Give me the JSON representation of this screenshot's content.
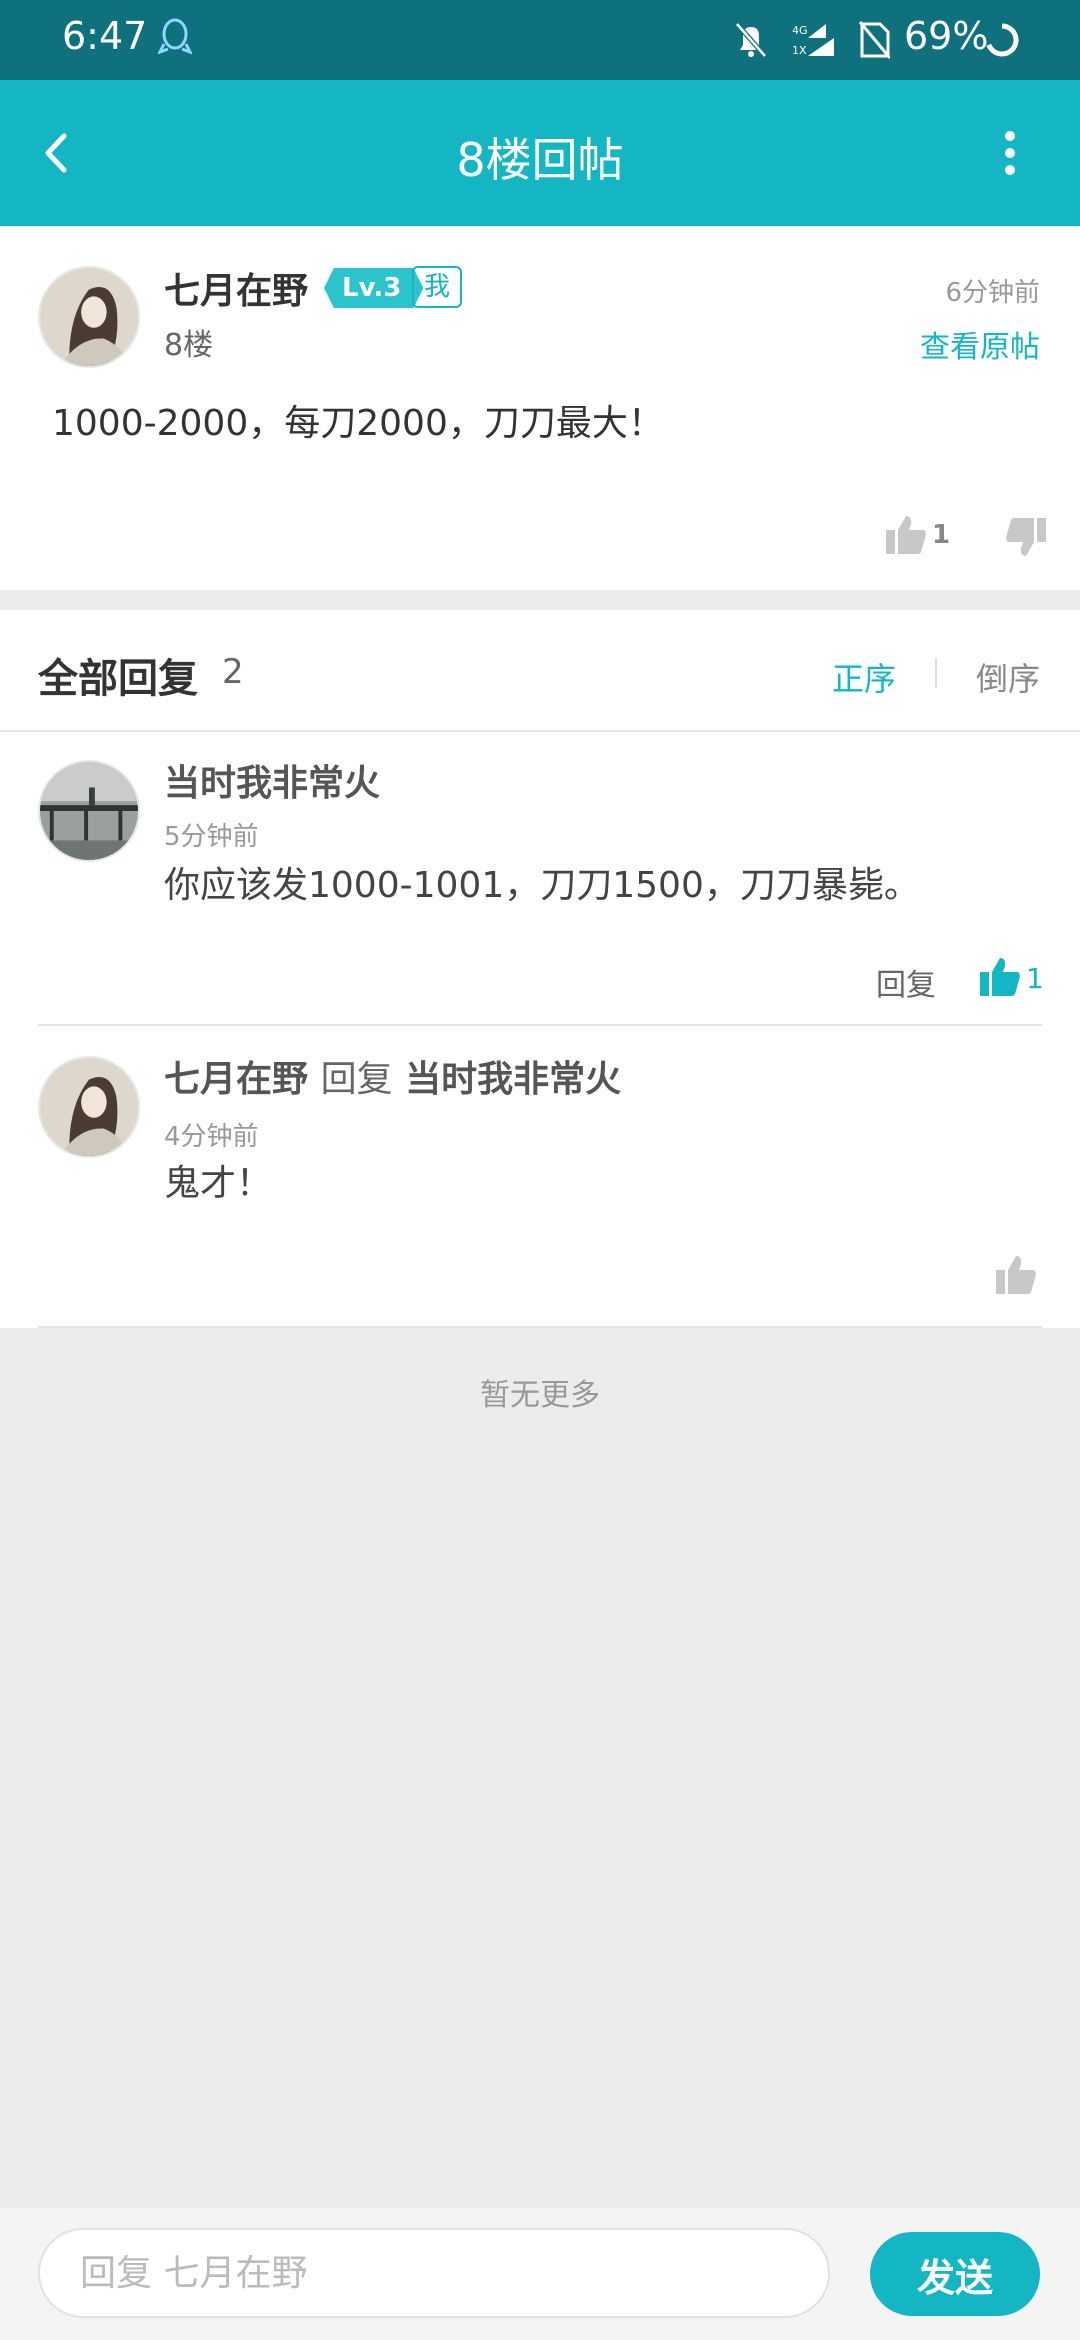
{
  "status_bar": {
    "time": "6:47",
    "battery": "69%",
    "network": "4G 1X"
  },
  "header": {
    "title": "8楼回帖",
    "back_icon": "chevron-left-icon",
    "more_icon": "more-vertical-icon"
  },
  "post": {
    "author": "七月在野",
    "level": "Lv.3",
    "me_badge": "我",
    "floor": "8楼",
    "time": "6分钟前",
    "view_original": "查看原帖",
    "content": "1000-2000，每刀2000，刀刀最大！",
    "like_count": "1"
  },
  "replies": {
    "heading": "全部回复",
    "count": "2",
    "sort_asc": "正序",
    "sort_desc": "倒序",
    "items": [
      {
        "author": "当时我非常火",
        "time": "5分钟前",
        "content": "你应该发1000-1001，刀刀1500，刀刀暴毙。",
        "reply_label": "回复",
        "like_count": "1"
      },
      {
        "author": "七月在野",
        "reply_word": "回复",
        "reply_to": "当时我非常火",
        "time": "4分钟前",
        "content": "鬼才！"
      }
    ]
  },
  "no_more": "暂无更多",
  "input": {
    "placeholder": "回复 七月在野",
    "send_label": "发送"
  },
  "colors": {
    "accent": "#14b6c4",
    "status_bar": "#0f707e"
  }
}
